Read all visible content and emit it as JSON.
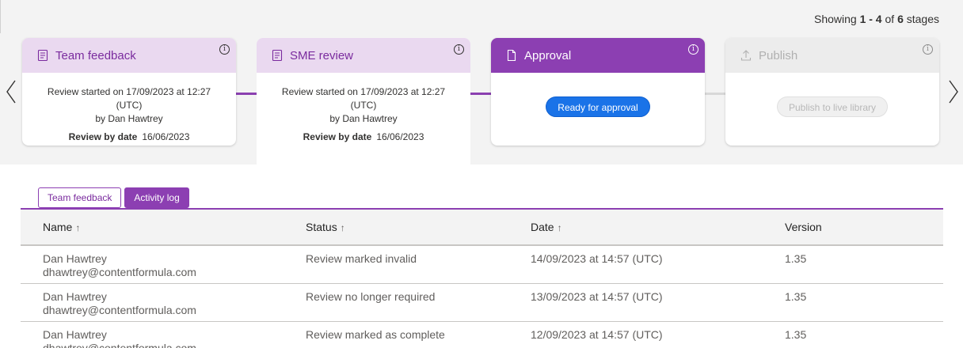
{
  "showing": {
    "prefix": "Showing",
    "range": "1 - 4",
    "of": "of",
    "total": "6",
    "suffix": "stages"
  },
  "stages": [
    {
      "title": "Team feedback",
      "icon": "checklist-icon",
      "started": "Review started on 17/09/2023 at 12:27 (UTC)",
      "by": "by Dan Hawtrey",
      "review_by_label": "Review by date",
      "review_by_date": "16/06/2023"
    },
    {
      "title": "SME review",
      "icon": "checklist-icon",
      "started": "Review started on 17/09/2023 at 12:27 (UTC)",
      "by": "by Dan Hawtrey",
      "review_by_label": "Review by date",
      "review_by_date": "16/06/2023"
    },
    {
      "title": "Approval",
      "icon": "document-icon",
      "action": "Ready for approval"
    },
    {
      "title": "Publish",
      "icon": "upload-icon",
      "action": "Publish to live library"
    }
  ],
  "info_glyph": "i",
  "tabs": [
    {
      "label": "Team feedback"
    },
    {
      "label": "Activity log"
    }
  ],
  "table": {
    "headers": {
      "name": "Name",
      "status": "Status",
      "date": "Date",
      "version": "Version"
    },
    "sort_glyph": "↑",
    "rows": [
      {
        "name": "Dan Hawtrey",
        "email": "dhawtrey@contentformula.com",
        "status": "Review marked invalid",
        "date": "14/09/2023 at 14:57 (UTC)",
        "version": "1.35"
      },
      {
        "name": "Dan Hawtrey",
        "email": "dhawtrey@contentformula.com",
        "status": "Review no longer required",
        "date": "13/09/2023 at 14:57 (UTC)",
        "version": "1.35"
      },
      {
        "name": "Dan Hawtrey",
        "email": "dhawtrey@contentformula.com",
        "status": "Review marked as complete",
        "date": "12/09/2023 at 14:57 (UTC)",
        "version": "1.35"
      }
    ]
  },
  "colors": {
    "accent": "#8c3fb2",
    "accent_light": "#ead9f0",
    "primary_button": "#1a73e8"
  }
}
